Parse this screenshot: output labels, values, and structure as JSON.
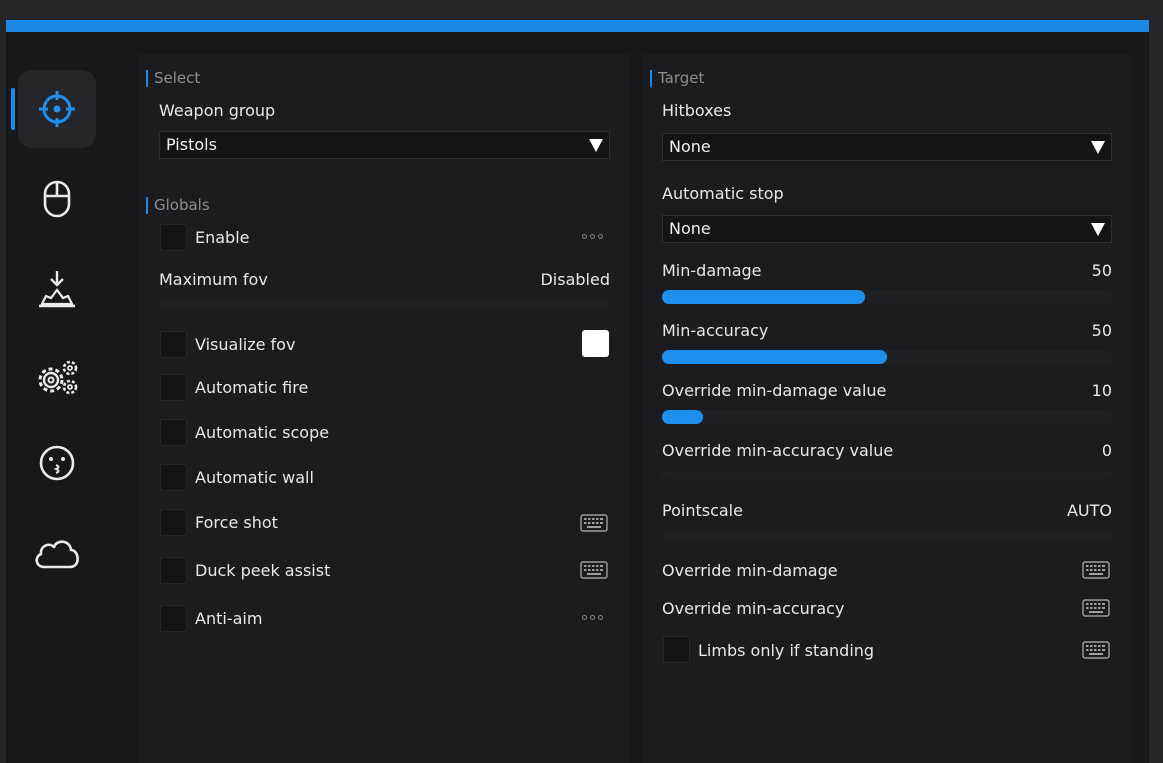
{
  "theme": {
    "accent": "#1e88e5",
    "slider_fill": "#1e8fee"
  },
  "sidebar": {
    "items": [
      {
        "icon": "crosshair-icon",
        "active": true
      },
      {
        "icon": "mouse-icon",
        "active": false
      },
      {
        "icon": "landmine-icon",
        "active": false
      },
      {
        "icon": "gears-icon",
        "active": false
      },
      {
        "icon": "kissing-face-icon",
        "active": false
      },
      {
        "icon": "cloud-icon",
        "active": false
      }
    ]
  },
  "left": {
    "select_title": "Select",
    "weapon_group_label": "Weapon group",
    "weapon_group_value": "Pistols",
    "globals_title": "Globals",
    "enable_label": "Enable",
    "max_fov_label": "Maximum fov",
    "max_fov_value": "Disabled",
    "visualize_fov_label": "Visualize fov",
    "visualize_fov_color": "#ffffff",
    "automatic_fire_label": "Automatic fire",
    "automatic_scope_label": "Automatic scope",
    "automatic_wall_label": "Automatic wall",
    "force_shot_label": "Force shot",
    "duck_peek_label": "Duck peek assist",
    "anti_aim_label": "Anti-aim"
  },
  "right": {
    "target_title": "Target",
    "hitboxes_label": "Hitboxes",
    "hitboxes_value": "None",
    "auto_stop_label": "Automatic stop",
    "auto_stop_value": "None",
    "min_damage_label": "Min-damage",
    "min_damage_value": "50",
    "min_damage_fraction": 0.45,
    "min_accuracy_label": "Min-accuracy",
    "min_accuracy_value": "50",
    "min_accuracy_fraction": 0.5,
    "override_min_damage_value_label": "Override min-damage value",
    "override_min_damage_value": "10",
    "override_min_damage_fraction": 0.09,
    "override_min_accuracy_value_label": "Override min-accuracy value",
    "override_min_accuracy_value": "0",
    "pointscale_label": "Pointscale",
    "pointscale_value": "AUTO",
    "override_min_damage_label": "Override min-damage",
    "override_min_accuracy_label": "Override min-accuracy",
    "limbs_label": "Limbs only if standing"
  }
}
